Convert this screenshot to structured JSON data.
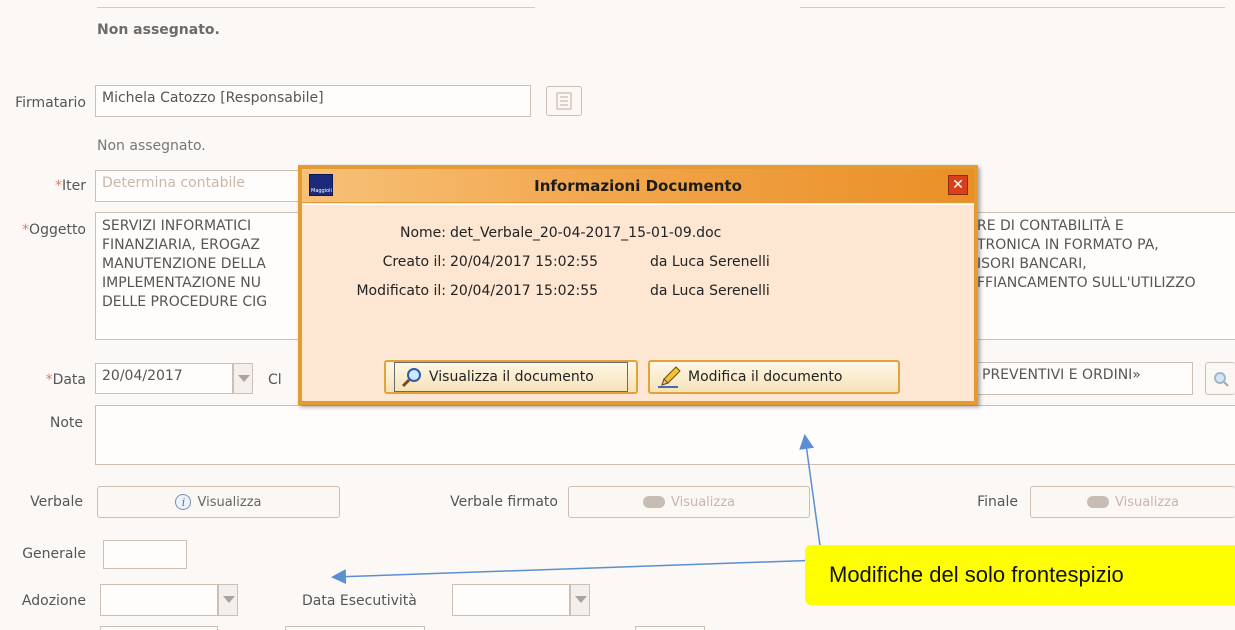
{
  "header": {
    "top_note": "Non assegnato."
  },
  "form": {
    "firmatario_label": "Firmatario",
    "firmatario_value": "Michela Catozzo [Responsabile]",
    "firmatario_note": "Non assegnato.",
    "iter_label": "Iter",
    "iter_value": "Determina contabile",
    "oggetto_label": "Oggetto",
    "oggetto_left": "SERVIZI INFORMATICI\nFINANZIARIA, EROGAZ\nMANUTENZIONE DELLA\nIMPLEMENTAZIONE NU\nDELLE PROCEDURE CIG",
    "oggetto_right": "RE DI CONTABILITÀ E\nTRONICA IN FORMATO PA,\nISORI BANCARI,\nFFIANCAMENTO SULL'UTILIZZO",
    "data_label": "Data",
    "data_value": "20/04/2017",
    "data_partial": "Cl",
    "classifica_value": "PREVENTIVI E ORDINI»",
    "note_label": "Note",
    "verbale_label": "Verbale",
    "verbale_button": "Visualizza",
    "verbale_firmato_label": "Verbale firmato",
    "verbale_firmato_button": "Visualizza",
    "finale_label": "Finale",
    "finale_button": "Visualizza",
    "generale_label": "Generale",
    "adozione_label": "Adozione",
    "data_esecutivita_label": "Data Esecutività"
  },
  "dialog": {
    "title": "Informazioni Documento",
    "logo_text": "Maggioli",
    "nome_label": "Nome:",
    "nome_value": "det_Verbale_20-04-2017_15-01-09.doc",
    "creato_label": "Creato il:",
    "creato_value": "20/04/2017 15:02:55",
    "creato_by": "da Luca Serenelli",
    "modificato_label": "Modificato il:",
    "modificato_value": "20/04/2017 15:02:55",
    "modificato_by": "da Luca Serenelli",
    "view_button": "Visualizza il documento",
    "edit_button": "Modifica il documento",
    "close_glyph": "✕"
  },
  "annotation": {
    "text": "Modifiche del  solo frontespizio",
    "color": "#ffff00",
    "arrow_color": "#5b8fd1"
  },
  "colors": {
    "dialog_border": "#e49b34",
    "required": "#e07a6b"
  }
}
